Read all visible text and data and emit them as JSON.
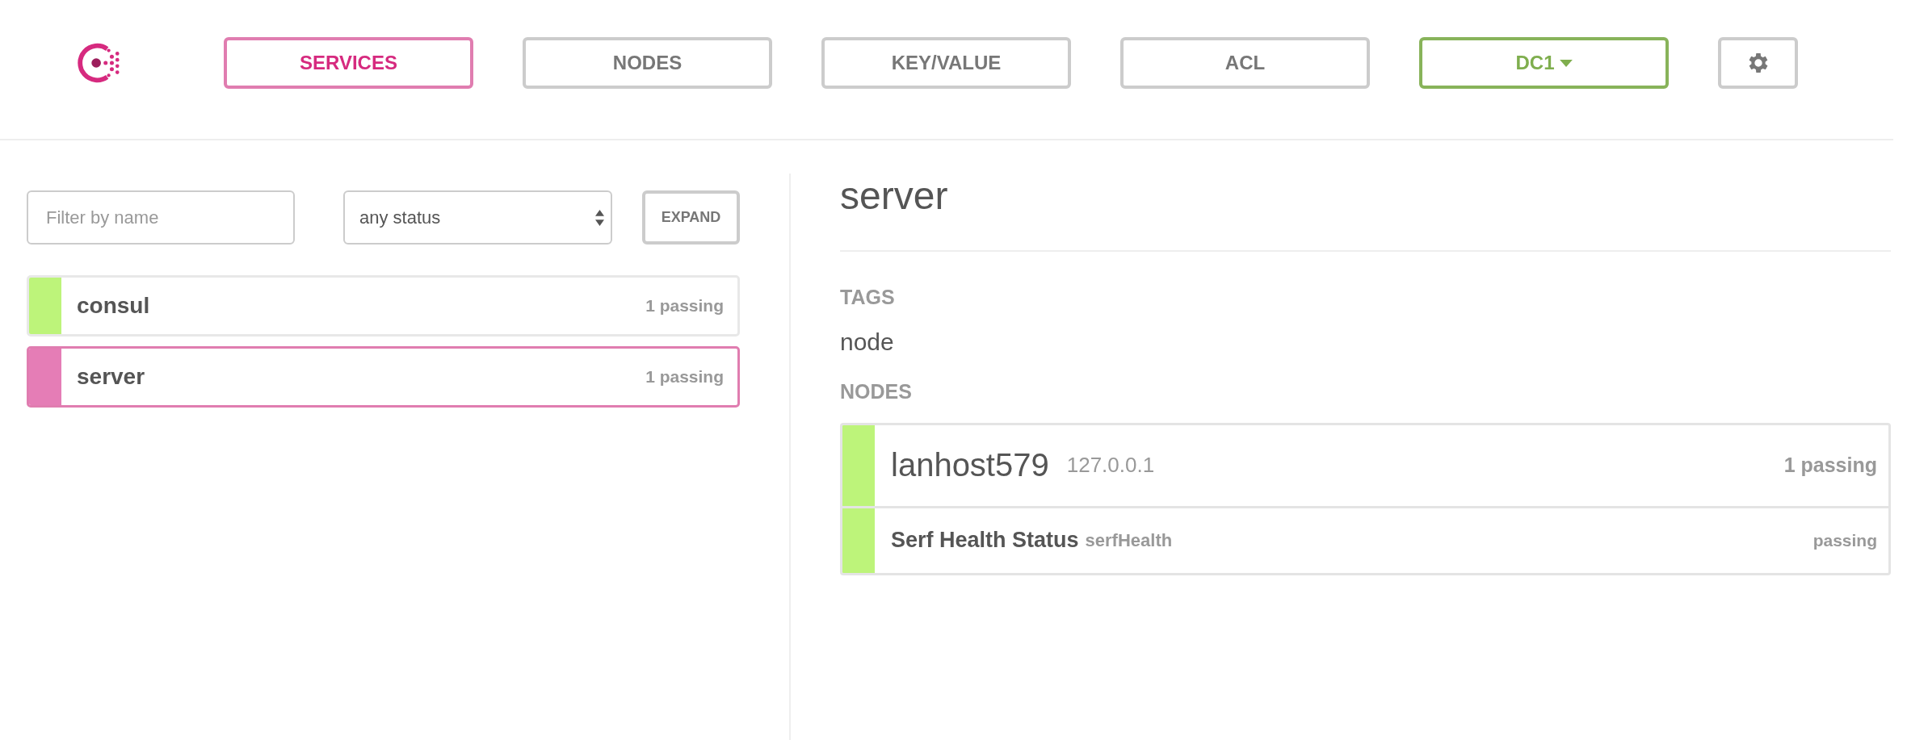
{
  "nav": [
    {
      "kind": "tab",
      "label": "SERVICES",
      "selected": true
    },
    {
      "kind": "tab",
      "label": "NODES",
      "selected": false
    },
    {
      "kind": "tab",
      "label": "KEY/VALUE",
      "selected": false
    },
    {
      "kind": "tab",
      "label": "ACL",
      "selected": false
    },
    {
      "kind": "datacenter",
      "label": "DC1"
    },
    {
      "kind": "settings"
    }
  ],
  "filter": {
    "placeholder": "Filter by name",
    "status": "any status",
    "expand": "EXPAND"
  },
  "services": [
    {
      "name": "consul",
      "checks": "1 passing",
      "selected": false
    },
    {
      "name": "server",
      "checks": "1 passing",
      "selected": true
    }
  ],
  "detail": {
    "title": "server",
    "tags_heading": "TAGS",
    "tags": [
      "node"
    ],
    "nodes_heading": "NODES",
    "nodes": [
      {
        "name": "lanhost579",
        "address": "127.0.0.1",
        "checks": "1 passing",
        "health_checks": [
          {
            "name": "Serf Health Status",
            "id": "serfHealth",
            "status": "passing"
          }
        ]
      }
    ]
  }
}
